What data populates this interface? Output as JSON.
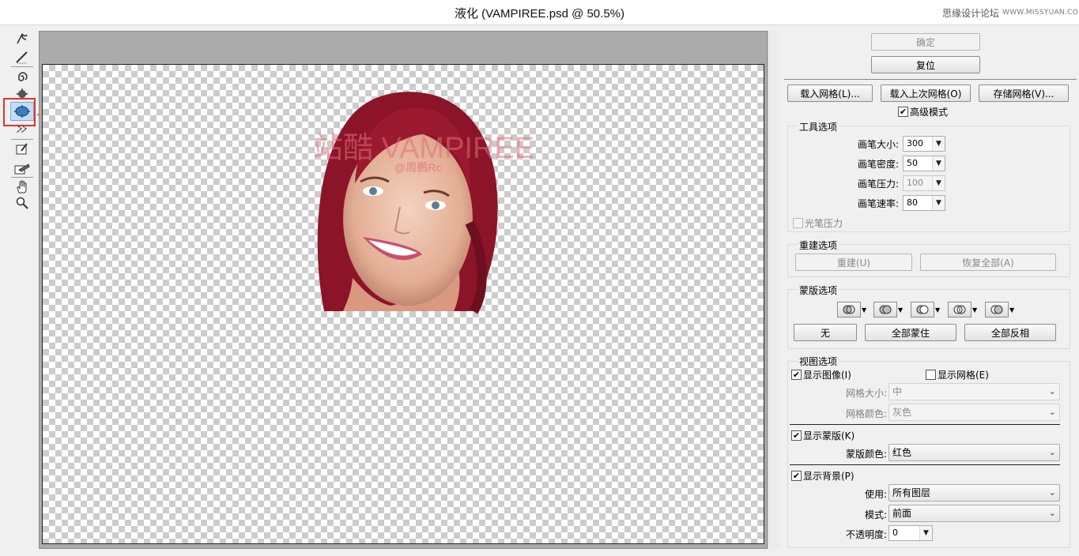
{
  "window": {
    "title": "液化 (VAMPIREE.psd @ 50.5%)",
    "watermark_cn": "思缘设计论坛",
    "watermark_url": "WWW.MISSYUAN.COM"
  },
  "tools": [
    "warp-tool",
    "reconstruct-tool",
    "twirl-tool",
    "pucker-tool",
    "bloat-tool",
    "push-left-tool",
    "freeze-mask-tool",
    "thaw-mask-tool",
    "hand-tool",
    "zoom-tool"
  ],
  "canvas": {
    "headline": "站酷 VAMPIREE",
    "handle": "@周鹏Rc"
  },
  "panel": {
    "ok": "确定",
    "reset": "复位",
    "load_mesh": "载入网格(L)...",
    "load_last_mesh": "载入上次网格(O)",
    "save_mesh": "存储网格(V)...",
    "advanced_mode": "高级模式",
    "tool_options": {
      "title": "工具选项",
      "brush_size": {
        "label": "画笔大小:",
        "value": "300"
      },
      "brush_density": {
        "label": "画笔密度:",
        "value": "50"
      },
      "brush_pressure": {
        "label": "画笔压力:",
        "value": "100"
      },
      "brush_rate": {
        "label": "画笔速率:",
        "value": "80"
      },
      "stylus_pressure": "光笔压力"
    },
    "reconstruct": {
      "title": "重建选项",
      "rebuild": "重建(U)",
      "restore_all": "恢复全部(A)"
    },
    "mask": {
      "title": "蒙版选项",
      "none": "无",
      "mask_all": "全部蒙住",
      "invert_all": "全部反相"
    },
    "view": {
      "title": "视图选项",
      "show_image": "显示图像(I)",
      "show_mesh": "显示网格(E)",
      "mesh_size_label": "网格大小:",
      "mesh_size_value": "中",
      "mesh_color_label": "网格颜色:",
      "mesh_color_value": "灰色",
      "show_mask": "显示蒙版(K)",
      "mask_color_label": "蒙版颜色:",
      "mask_color_value": "红色",
      "show_backdrop": "显示背景(P)",
      "use_label": "使用:",
      "use_value": "所有图层",
      "mode_label": "模式:",
      "mode_value": "前面",
      "opacity_label": "不透明度:",
      "opacity_value": "0"
    }
  }
}
